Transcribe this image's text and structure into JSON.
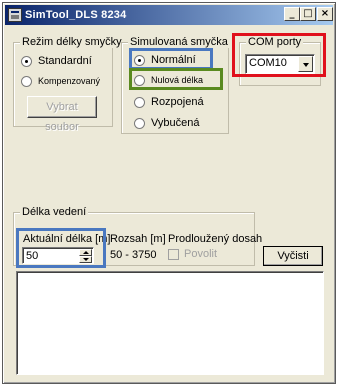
{
  "window": {
    "title": "SimTool_DLS 8234",
    "minimize_glyph": "_",
    "maximize_glyph": "□",
    "close_glyph": "×"
  },
  "loop_mode": {
    "legend": "Režim délky smyčky",
    "options": [
      {
        "label": "Standardní",
        "selected": true
      },
      {
        "label": "Kompenzovaný",
        "selected": false
      }
    ],
    "select_file_button": "Vybrat soubor"
  },
  "simulated_loop": {
    "legend": "Simulovaná smyčka",
    "options": [
      {
        "label": "Normální",
        "selected": true
      },
      {
        "label": "Nulová délka",
        "selected": false
      },
      {
        "label": "Rozpojená",
        "selected": false
      },
      {
        "label": "Vybučená",
        "selected": false
      }
    ]
  },
  "com_ports": {
    "legend": "COM porty",
    "selected": "COM10"
  },
  "line_length": {
    "legend": "Délka vedení",
    "current_length_label": "Aktuální délka [m]",
    "current_length_value": "50",
    "range_label": "Rozsah [m]",
    "range_value": "50 - 3750",
    "extended_range_label": "Prodloužený dosah",
    "allow_label": "Povolit",
    "clear_button": "Vyčisti"
  },
  "highlight_colors": {
    "red": "#e0101c",
    "blue": "#4a78c0",
    "green": "#5a8a20"
  }
}
